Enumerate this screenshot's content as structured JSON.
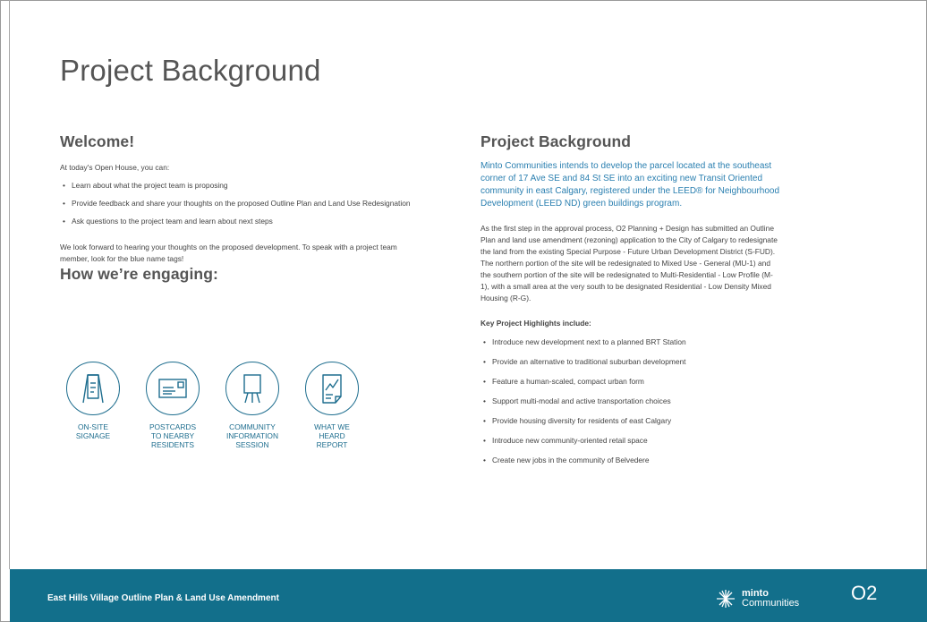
{
  "page": {
    "title": "Project Background"
  },
  "welcome": {
    "heading": "Welcome!",
    "intro": "At today's Open House, you can:",
    "bullets": [
      "Learn about what the project team is proposing",
      "Provide feedback and share your thoughts on the proposed Outline Plan and Land Use Redesignation",
      "Ask questions to the project team and learn about next steps"
    ],
    "closing": "We look forward to hearing your thoughts on the proposed development. To speak with a project team member, look for the blue name tags!"
  },
  "engaging": {
    "heading": "How we’re engaging:",
    "items": [
      {
        "icon": "signage-icon",
        "label": "ON-SITE\nSIGNAGE"
      },
      {
        "icon": "postcard-icon",
        "label": "POSTCARDS\nTO NEARBY\nRESIDENTS"
      },
      {
        "icon": "easel-icon",
        "label": "COMMUNITY\nINFORMATION\nSESSION"
      },
      {
        "icon": "report-icon",
        "label": "WHAT WE\nHEARD\nREPORT"
      }
    ]
  },
  "background": {
    "heading": "Project Background",
    "lead": "Minto Communities intends to develop the parcel located at the southeast corner of 17 Ave SE and 84 St SE into an exciting new Transit Oriented community in east Calgary, registered under the LEED® for Neighbourhood Development (LEED ND) green buildings program.",
    "body": "As the first step in the approval process, O2 Planning + Design has submitted an Outline Plan and land use amendment (rezoning) application to the City of Calgary to redesignate the land from the existing Special Purpose - Future Urban Development District (S-FUD). The northern portion of the site will be redesignated to Mixed Use - General (MU-1) and the southern portion of the site will be redesignated to Multi-Residential - Low Profile (M-1), with a small area at the very south to be designated Residential - Low Density Mixed Housing (R-G).",
    "key_title": "Key Project Highlights include:",
    "highlights": [
      "Introduce new development next to a planned BRT Station",
      "Provide an alternative to traditional suburban development",
      "Feature a human-scaled, compact urban form",
      "Support multi-modal and active transportation choices",
      "Provide housing diversity for residents of east Calgary",
      "Introduce new community-oriented retail space",
      "Create new jobs in the community of Belvedere"
    ]
  },
  "footer": {
    "title": "East Hills Village Outline Plan & Land Use Amendment",
    "minto_line1": "minto",
    "minto_line2": "Communities",
    "o2": "O2"
  },
  "colors": {
    "accent": "#126f8b",
    "icon": "#1d6d8e",
    "lead_text": "#2a7fb0"
  }
}
